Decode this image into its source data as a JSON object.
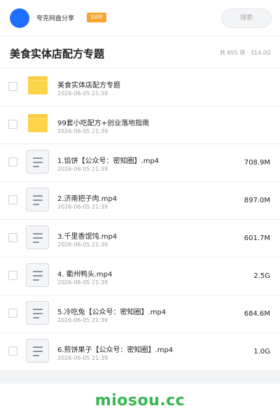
{
  "header": {
    "user_name": "夸克网盘分享",
    "vip_badge": "SVIP",
    "search_placeholder": "搜索"
  },
  "title_bar": {
    "title": "美食实体店配方专题",
    "summary": "共 655 项 · 314.0G"
  },
  "files": [
    {
      "type": "folder",
      "icon": "folder-icon",
      "name": "美食实体店配方专题",
      "date": "2026-06-05 21:39",
      "size": ""
    },
    {
      "type": "folder",
      "icon": "folder-icon",
      "name": "99套小吃配方+创业落地指南",
      "date": "2026-06-05 21:39",
      "size": ""
    },
    {
      "type": "video",
      "icon": "document-icon",
      "name": "1.馅饼【公众号：密知圈】.mp4",
      "date": "2026-06-05 21:39",
      "size": "708.9M"
    },
    {
      "type": "video",
      "icon": "document-icon",
      "name": "2.济南把子肉.mp4",
      "date": "2026-06-05 21:39",
      "size": "897.0M"
    },
    {
      "type": "video",
      "icon": "document-icon",
      "name": "3.千里香馄饨.mp4",
      "date": "2026-06-05 21:39",
      "size": "601.7M"
    },
    {
      "type": "video",
      "icon": "document-icon",
      "name": "4. 衢州鸭头.mp4",
      "date": "2026-06-05 21:39",
      "size": "2.5G"
    },
    {
      "type": "video",
      "icon": "document-icon",
      "name": "5.冷吃兔【公众号：密知圈】.mp4",
      "date": "2026-06-05 21:39",
      "size": "684.6M"
    },
    {
      "type": "video",
      "icon": "document-icon",
      "name": "6.煎饼果子【公众号：密知圈】.mp4",
      "date": "2026-06-05 21:39",
      "size": "1.0G"
    }
  ],
  "footer": {
    "watermark": "miosou.cc"
  },
  "colors": {
    "accent_blue": "#1f6fff",
    "vip_orange": "#f7a530",
    "folder_yellow": "#fbd448",
    "watermark_green": "#35b84f"
  }
}
